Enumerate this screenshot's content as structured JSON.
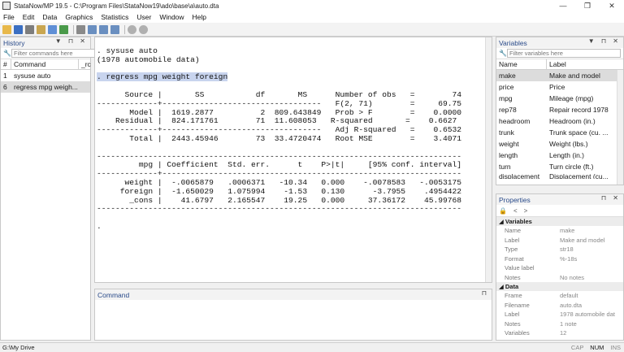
{
  "window": {
    "title": "StataNow/MP 19.5 - C:\\Program Files\\StataNow19\\ado\\base\\a\\auto.dta",
    "controls": [
      "—",
      "❐",
      "✕"
    ]
  },
  "menu": [
    "File",
    "Edit",
    "Data",
    "Graphics",
    "Statistics",
    "User",
    "Window",
    "Help"
  ],
  "history": {
    "title": "History",
    "filter_placeholder": "Filter commands here",
    "col_num": "#",
    "col_command": "Command",
    "col_rc": "_rc",
    "items": [
      {
        "num": "1",
        "cmd": "sysuse auto"
      },
      {
        "num": "6",
        "cmd": "regress mpg weigh..."
      }
    ]
  },
  "results": {
    "lines": [
      ". sysuse auto",
      "(1978 automobile data)",
      "",
      ". regress mpg weight foreign",
      "",
      "      Source |       SS           df       MS      Number of obs   =        74",
      "-------------+----------------------------------   F(2, 71)        =     69.75",
      "       Model |  1619.2877          2  809.643849   Prob > F        =    0.0000",
      "    Residual |  824.171761        71  11.608053   R-squared       =    0.6627",
      "-------------+----------------------------------   Adj R-squared   =    0.6532",
      "       Total |  2443.45946        73  33.4720474   Root MSE        =    3.4071",
      "",
      "------------------------------------------------------------------------------",
      "         mpg | Coefficient  Std. err.      t    P>|t|     [95% conf. interval]",
      "-------------+----------------------------------------------------------------",
      "      weight |  -.0065879   .0006371   -10.34   0.000    -.0078583   -.0053175",
      "     foreign |  -1.650029   1.075994    -1.53   0.130      -3.7955    .4954422",
      "       _cons |    41.6797   2.165547    19.25   0.000     37.36172    45.99768",
      "------------------------------------------------------------------------------",
      "",
      "."
    ]
  },
  "command": {
    "title": "Command"
  },
  "variables": {
    "title": "Variables",
    "filter_placeholder": "Filter variables here",
    "col_name": "Name",
    "col_label": "Label",
    "items": [
      {
        "name": "make",
        "label": "Make and model"
      },
      {
        "name": "price",
        "label": "Price"
      },
      {
        "name": "mpg",
        "label": "Mileage (mpg)"
      },
      {
        "name": "rep78",
        "label": "Repair record 1978"
      },
      {
        "name": "headroom",
        "label": "Headroom (in.)"
      },
      {
        "name": "trunk",
        "label": "Trunk space (cu. ..."
      },
      {
        "name": "weight",
        "label": "Weight (lbs.)"
      },
      {
        "name": "length",
        "label": "Length (in.)"
      },
      {
        "name": "turn",
        "label": "Turn circle (ft.)"
      },
      {
        "name": "displacement",
        "label": "Displacement (cu..."
      }
    ]
  },
  "properties": {
    "title": "Properties",
    "var_section": "Variables",
    "var_rows": [
      {
        "k": "Name",
        "v": "make"
      },
      {
        "k": "Label",
        "v": "Make and model"
      },
      {
        "k": "Type",
        "v": "str18"
      },
      {
        "k": "Format",
        "v": "%-18s"
      },
      {
        "k": "Value label",
        "v": ""
      },
      {
        "k": "Notes",
        "v": "No notes"
      }
    ],
    "data_section": "Data",
    "data_rows": [
      {
        "k": "Frame",
        "v": "default"
      },
      {
        "k": "Filename",
        "v": "auto.dta"
      },
      {
        "k": "Label",
        "v": "1978 automobile dat"
      },
      {
        "k": "Notes",
        "v": "1 note"
      },
      {
        "k": "Variables",
        "v": "12"
      }
    ]
  },
  "status": {
    "path": "G:\\My Drive",
    "cap": "CAP",
    "num": "NUM",
    "ins": "INS"
  }
}
